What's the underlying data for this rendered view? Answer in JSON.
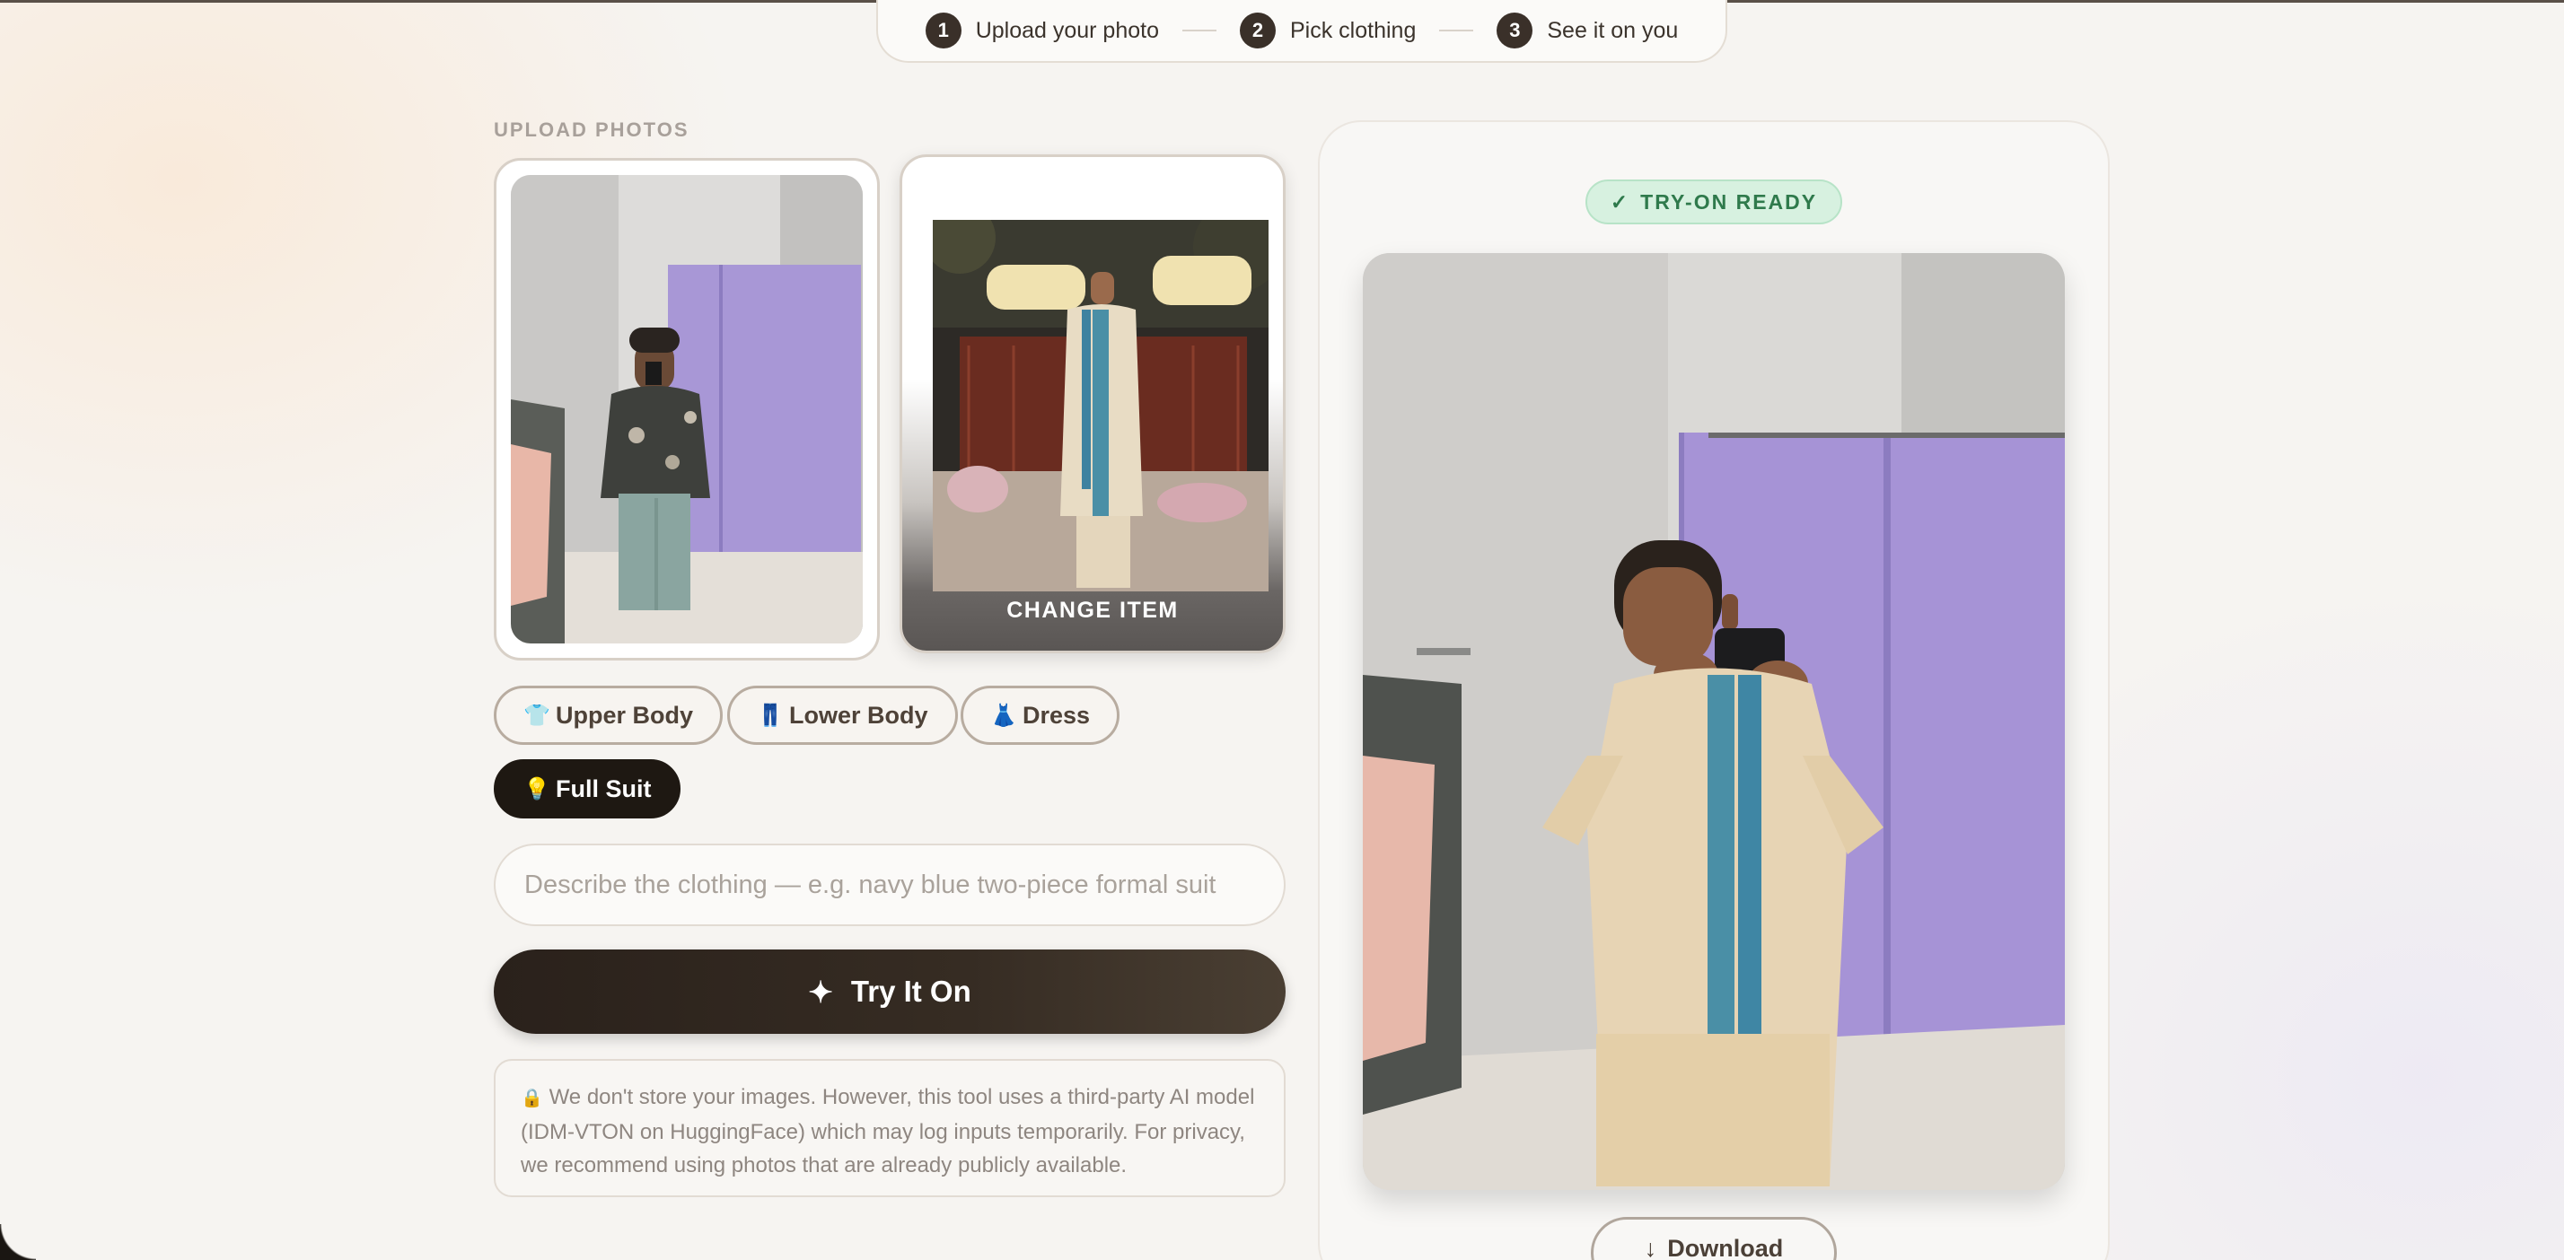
{
  "stepper": {
    "steps": [
      {
        "num": "1",
        "label": "Upload your photo"
      },
      {
        "num": "2",
        "label": "Pick clothing"
      },
      {
        "num": "3",
        "label": "See it on you"
      }
    ]
  },
  "upload": {
    "section_label": "UPLOAD PHOTOS",
    "change_item_label": "CHANGE ITEM"
  },
  "categories": [
    {
      "icon": "shirt-icon",
      "glyph": "👕",
      "label": "Upper Body",
      "active": false
    },
    {
      "icon": "pants-icon",
      "glyph": "👖",
      "label": "Lower Body",
      "active": false
    },
    {
      "icon": "dress-icon",
      "glyph": "👗",
      "label": "Dress",
      "active": false
    },
    {
      "icon": "lightbulb-icon",
      "glyph": "💡",
      "label": "Full Suit",
      "active": true
    }
  ],
  "description": {
    "value": "",
    "placeholder": "Describe the clothing — e.g. navy blue two-piece formal suit"
  },
  "try_on": {
    "icon": "sparkle-icon",
    "glyph": "✦",
    "label": "Try It On"
  },
  "privacy_notice": {
    "icon": "lock-icon",
    "glyph": "🔒",
    "text": "We don't store your images. However, this tool uses a third-party AI model (IDM-VTON on HuggingFace) which may log inputs temporarily. For privacy, we recommend using photos that are already publicly available."
  },
  "result": {
    "badge_glyph": "✓",
    "badge_label": "TRY-ON READY",
    "download_glyph": "↓",
    "download_label": "Download"
  },
  "colors": {
    "accent_dark": "#1e1812",
    "success": "#2f7a4c",
    "wall_purple": "#a896d8"
  }
}
